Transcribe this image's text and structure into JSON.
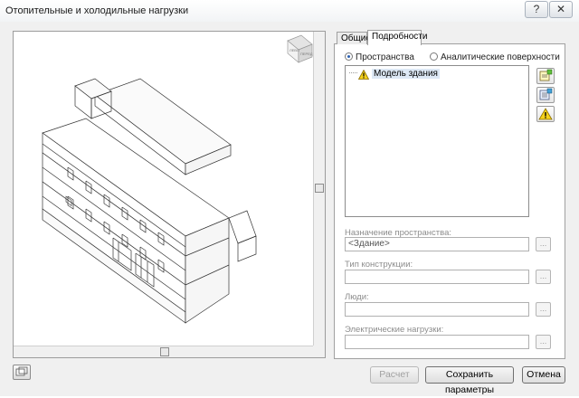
{
  "window": {
    "title": "Отопительные и холодильные нагрузки",
    "help_glyph": "?",
    "close_glyph": "✕"
  },
  "viewport": {
    "viewcube_faces": [
      "ЛЕВО",
      "ПЕРЕД"
    ]
  },
  "tabs": [
    {
      "label": "Общие",
      "active": false
    },
    {
      "label": "Подробности",
      "active": true
    }
  ],
  "details": {
    "radio_spaces": "Пространства",
    "radio_surfaces": "Аналитические поверхности",
    "selected_radio": "spaces",
    "tree_item": "Модель здания",
    "space_purpose_label": "Назначение пространства:",
    "space_purpose_value": "<Здание>",
    "construction_type_label": "Тип конструкции:",
    "construction_type_value": "",
    "people_label": "Люди:",
    "people_value": "",
    "electrical_loads_label": "Электрические нагрузки:",
    "electrical_loads_value": "",
    "browse_glyph": "..."
  },
  "buttons": {
    "calculate": "Расчет",
    "save_settings": "Сохранить параметры",
    "cancel": "Отмена"
  },
  "colors": {
    "warning_yellow": "#f5d21c",
    "selection": "#dde8f5"
  }
}
